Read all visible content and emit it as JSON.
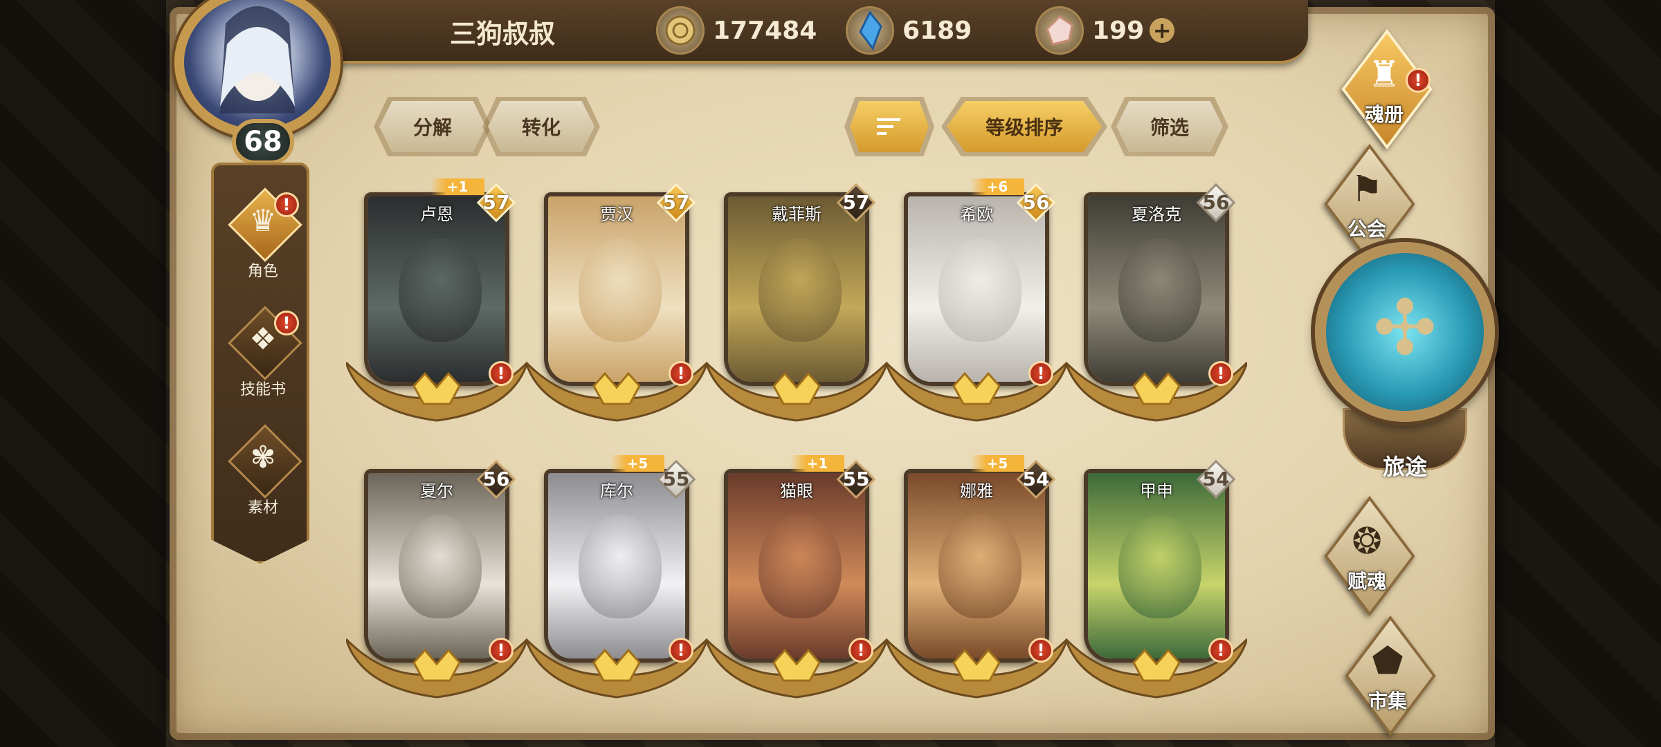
{
  "player": {
    "name": "三狗叔叔",
    "level": "68"
  },
  "currencies": [
    {
      "icon": "gold-coin-icon",
      "value": "177484"
    },
    {
      "icon": "blue-crystal-icon",
      "value": "6189"
    },
    {
      "icon": "pink-gem-icon",
      "value": "199",
      "plus": "+"
    }
  ],
  "toolbar": {
    "decompose": "分解",
    "convert": "转化",
    "sort_icon": "sort-icon",
    "sort_by_level": "等级排序",
    "filter": "筛选"
  },
  "left_nav": [
    {
      "label": "角色",
      "icon": "character-icon",
      "alert": "!"
    },
    {
      "label": "技能书",
      "icon": "skill-book-icon",
      "alert": "!"
    },
    {
      "label": "素材",
      "icon": "material-icon",
      "alert": ""
    }
  ],
  "right_nav": {
    "soul_book": {
      "label": "魂册",
      "icon": "soul-book-icon",
      "alert": "!"
    },
    "guild": {
      "label": "公会",
      "icon": "guild-icon"
    },
    "journey": {
      "label": "旅途",
      "icon": "journey-icon"
    },
    "soul_grant": {
      "label": "赋魂",
      "icon": "soul-grant-icon"
    },
    "market": {
      "label": "市集",
      "icon": "market-icon"
    }
  },
  "heroes": [
    {
      "name": "卢恩",
      "level": "57",
      "bonus": "+1",
      "badge": "gold",
      "alert": "!",
      "colors": [
        "#2b2d2e",
        "#5e6a66"
      ]
    },
    {
      "name": "贾汉",
      "level": "57",
      "bonus": "",
      "badge": "gold",
      "alert": "!",
      "colors": [
        "#c9a36a",
        "#efe0c0"
      ]
    },
    {
      "name": "戴菲斯",
      "level": "57",
      "bonus": "",
      "badge": "dark",
      "alert": "",
      "colors": [
        "#6c5a33",
        "#c2a858"
      ]
    },
    {
      "name": "希欧",
      "level": "56",
      "bonus": "+6",
      "badge": "gold",
      "alert": "!",
      "colors": [
        "#b9b3ad",
        "#f1efe9"
      ]
    },
    {
      "name": "夏洛克",
      "level": "56",
      "bonus": "",
      "badge": "silver",
      "alert": "!",
      "colors": [
        "#3f3d35",
        "#8f8a78"
      ]
    },
    {
      "name": "夏尔",
      "level": "56",
      "bonus": "",
      "badge": "dark",
      "alert": "!",
      "colors": [
        "#6b6559",
        "#e8e3d8"
      ]
    },
    {
      "name": "库尔",
      "level": "55",
      "bonus": "+5",
      "badge": "silver",
      "alert": "!",
      "colors": [
        "#8c8c91",
        "#f2f2f4"
      ]
    },
    {
      "name": "猫眼",
      "level": "55",
      "bonus": "+1",
      "badge": "dark",
      "alert": "!",
      "colors": [
        "#6a3b2b",
        "#d08a5a"
      ]
    },
    {
      "name": "娜雅",
      "level": "54",
      "bonus": "+5",
      "badge": "dark",
      "alert": "!",
      "colors": [
        "#7a4a2a",
        "#e2b27a"
      ]
    },
    {
      "name": "甲申",
      "level": "54",
      "bonus": "",
      "badge": "silver",
      "alert": "!",
      "colors": [
        "#3d6a3a",
        "#c7d46a"
      ]
    }
  ]
}
